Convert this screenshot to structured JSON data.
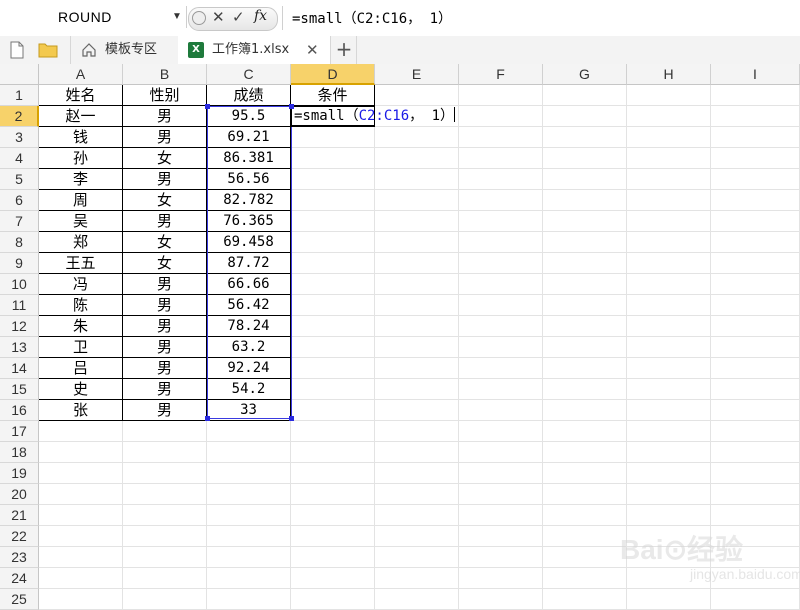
{
  "formula_bar": {
    "name_box": "ROUND",
    "formula": "=small（C2:C16， 1）"
  },
  "tabs": {
    "template_label": "模板专区",
    "workbook_label": "工作簿1.xlsx",
    "plus": "+",
    "close": "✕"
  },
  "columns": [
    "A",
    "B",
    "C",
    "D",
    "E",
    "F",
    "G",
    "H",
    "I"
  ],
  "rows": [
    "1",
    "2",
    "3",
    "4",
    "5",
    "6",
    "7",
    "8",
    "9",
    "10",
    "11",
    "12",
    "13",
    "14",
    "15",
    "16",
    "17",
    "18",
    "19",
    "20",
    "21",
    "22",
    "23",
    "24",
    "25"
  ],
  "headers": {
    "a": "姓名",
    "b": "性别",
    "c": "成绩",
    "d": "条件"
  },
  "table": [
    {
      "name": "赵一",
      "gender": "男",
      "score": "95.5"
    },
    {
      "name": "钱",
      "gender": "男",
      "score": "69.21"
    },
    {
      "name": "孙",
      "gender": "女",
      "score": "86.381"
    },
    {
      "name": "李",
      "gender": "男",
      "score": "56.56"
    },
    {
      "name": "周",
      "gender": "女",
      "score": "82.782"
    },
    {
      "name": "吴",
      "gender": "男",
      "score": "76.365"
    },
    {
      "name": "郑",
      "gender": "女",
      "score": "69.458"
    },
    {
      "name": "王五",
      "gender": "女",
      "score": "87.72"
    },
    {
      "name": "冯",
      "gender": "男",
      "score": "66.66"
    },
    {
      "name": "陈",
      "gender": "男",
      "score": "56.42"
    },
    {
      "name": "朱",
      "gender": "男",
      "score": "78.24"
    },
    {
      "name": "卫",
      "gender": "男",
      "score": "63.2"
    },
    {
      "name": "吕",
      "gender": "男",
      "score": "92.24"
    },
    {
      "name": "史",
      "gender": "男",
      "score": "54.2"
    },
    {
      "name": "张",
      "gender": "男",
      "score": "33"
    }
  ],
  "edit_cell": {
    "prefix": "=small（",
    "ref": "C2:C16",
    "suffix": "， 1）"
  },
  "watermark": {
    "text": "Bai⊙经验",
    "sub": "jingyan.baidu.com"
  },
  "colors": {
    "selected_header": "#f7d26a",
    "range_border": "#3a3ae0",
    "excel_green": "#1e7a3c"
  }
}
